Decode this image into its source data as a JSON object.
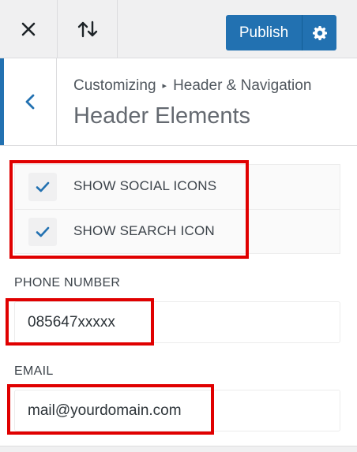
{
  "toolbar": {
    "close_icon": "close-icon",
    "sort_icon": "sort-arrows-icon",
    "publish_label": "Publish",
    "settings_icon": "gear-icon"
  },
  "section": {
    "breadcrumb_root": "Customizing",
    "breadcrumb_separator": "▸",
    "breadcrumb_parent": "Header & Navigation",
    "title": "Header Elements"
  },
  "options": {
    "show_social_icons": {
      "label": "SHOW SOCIAL ICONS",
      "checked": true
    },
    "show_search_icon": {
      "label": "SHOW SEARCH ICON",
      "checked": true
    }
  },
  "fields": {
    "phone": {
      "label": "PHONE NUMBER",
      "value": "085647xxxxx"
    },
    "email": {
      "label": "EMAIL",
      "value": "mail@yourdomain.com"
    }
  },
  "colors": {
    "accent": "#2271b1",
    "highlight": "#e00000"
  }
}
